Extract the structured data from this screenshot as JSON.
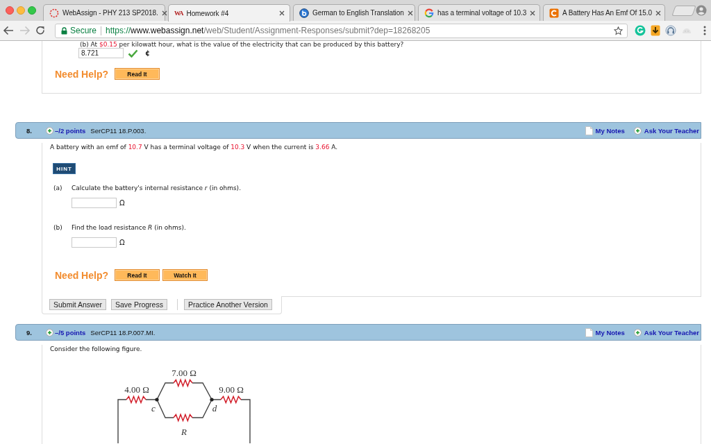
{
  "browser": {
    "tabs": [
      {
        "title": "WebAssign - PHY 213 SP2018.",
        "kind": "ring",
        "selected": false
      },
      {
        "title": "Homework #4",
        "kind": "letters",
        "icon_text": "WA",
        "selected": true
      },
      {
        "title": "German to English Translation",
        "kind": "circle",
        "selected": false
      },
      {
        "title": "has a terminal voltage of 10.3",
        "kind": "arc",
        "selected": false
      },
      {
        "title": "A Battery Has An Emf Of 15.0",
        "kind": "square",
        "selected": false
      }
    ],
    "can_go_forward": false,
    "address": {
      "secure_label": "Secure",
      "scheme": "https://",
      "host": "www.webassign.net",
      "path": "/web/Student/Assignment-Responses/submit?dep=18268205"
    }
  },
  "previous_problem": {
    "question_tail": [
      {
        "text": "(b) At ",
        "kind": "plain"
      },
      {
        "text": "$0.15",
        "kind": "value"
      },
      {
        "text": " per kilowatt hour, what is the value of the electricity that can be produced by this battery?",
        "kind": "plain"
      }
    ],
    "answer": {
      "value": "8.721",
      "correct": true,
      "unit": "¢"
    },
    "help": {
      "label": "Need Help?",
      "buttons": [
        "Read It"
      ]
    }
  },
  "problems": [
    {
      "number": "8.",
      "points": "–/2 points",
      "code": "SerCP11 18.P.003.",
      "notes": "My Notes",
      "ask": "Ask Your Teacher",
      "question": [
        {
          "text": "A battery with an emf of ",
          "kind": "plain"
        },
        {
          "text": "10.7",
          "kind": "value"
        },
        {
          "text": " V has a terminal voltage of ",
          "kind": "plain"
        },
        {
          "text": "10.3",
          "kind": "value"
        },
        {
          "text": " V when the current is ",
          "kind": "plain"
        },
        {
          "text": "3.66",
          "kind": "value"
        },
        {
          "text": " A.",
          "kind": "plain"
        }
      ],
      "hint": "HINT",
      "parts": [
        {
          "label": "(a)",
          "text": "Calculate the battery's internal resistance *r* (in ohms).",
          "unit": "Ω"
        },
        {
          "label": "(b)",
          "text": "Find the load resistance *R* (in ohms).",
          "unit": "Ω"
        }
      ],
      "help": {
        "label": "Need Help?",
        "buttons": [
          "Read It",
          "Watch It"
        ]
      },
      "actions": [
        [
          "Submit Answer",
          "Save Progress"
        ],
        [
          "Practice Another Version"
        ]
      ]
    },
    {
      "number": "9.",
      "points": "–/5 points",
      "code": "SerCP11 18.P.007.MI.",
      "notes": "My Notes",
      "ask": "Ask Your Teacher",
      "intro": "Consider the following figure.",
      "figure": {
        "top_resistor": "7.00 Ω",
        "left_resistor": "4.00 Ω",
        "right_resistor": "9.00 Ω",
        "bottom_resistor": "R",
        "left_node": "c",
        "right_node": "d"
      }
    }
  ]
}
